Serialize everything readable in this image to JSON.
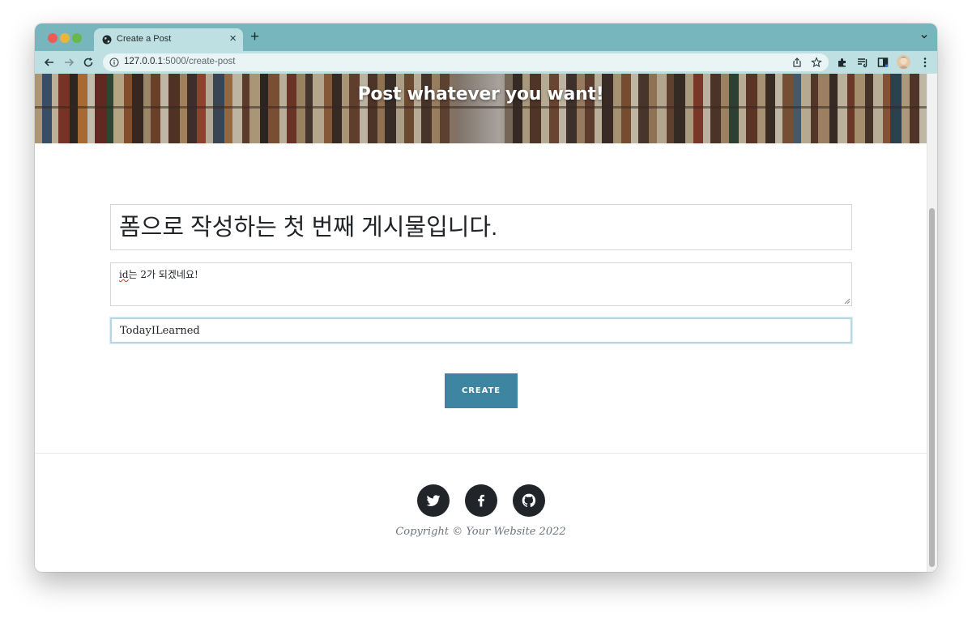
{
  "browser": {
    "tab_title": "Create a Post",
    "tab_close_glyph": "×",
    "new_tab_glyph": "+",
    "url_host": "127.0.0.1",
    "url_rest": ":5000/create-post"
  },
  "hero": {
    "title": "Post whatever you want!"
  },
  "form": {
    "title_value": "폼으로 작성하는 첫 번째 게시물입니다.",
    "body_value_prefix": "id",
    "body_value_suffix": "는 2가 되겠네요!",
    "tag_value": "TodayILearned",
    "submit_label": "CREATE"
  },
  "footer": {
    "social_icons": [
      "twitter-icon",
      "facebook-icon",
      "github-icon"
    ],
    "copyright": "Copyright © Your Website 2022"
  },
  "colors": {
    "tab_strip": "#78b6bd",
    "toolbar": "#bfe0e2",
    "button": "#3d85a0",
    "social": "#212529"
  }
}
